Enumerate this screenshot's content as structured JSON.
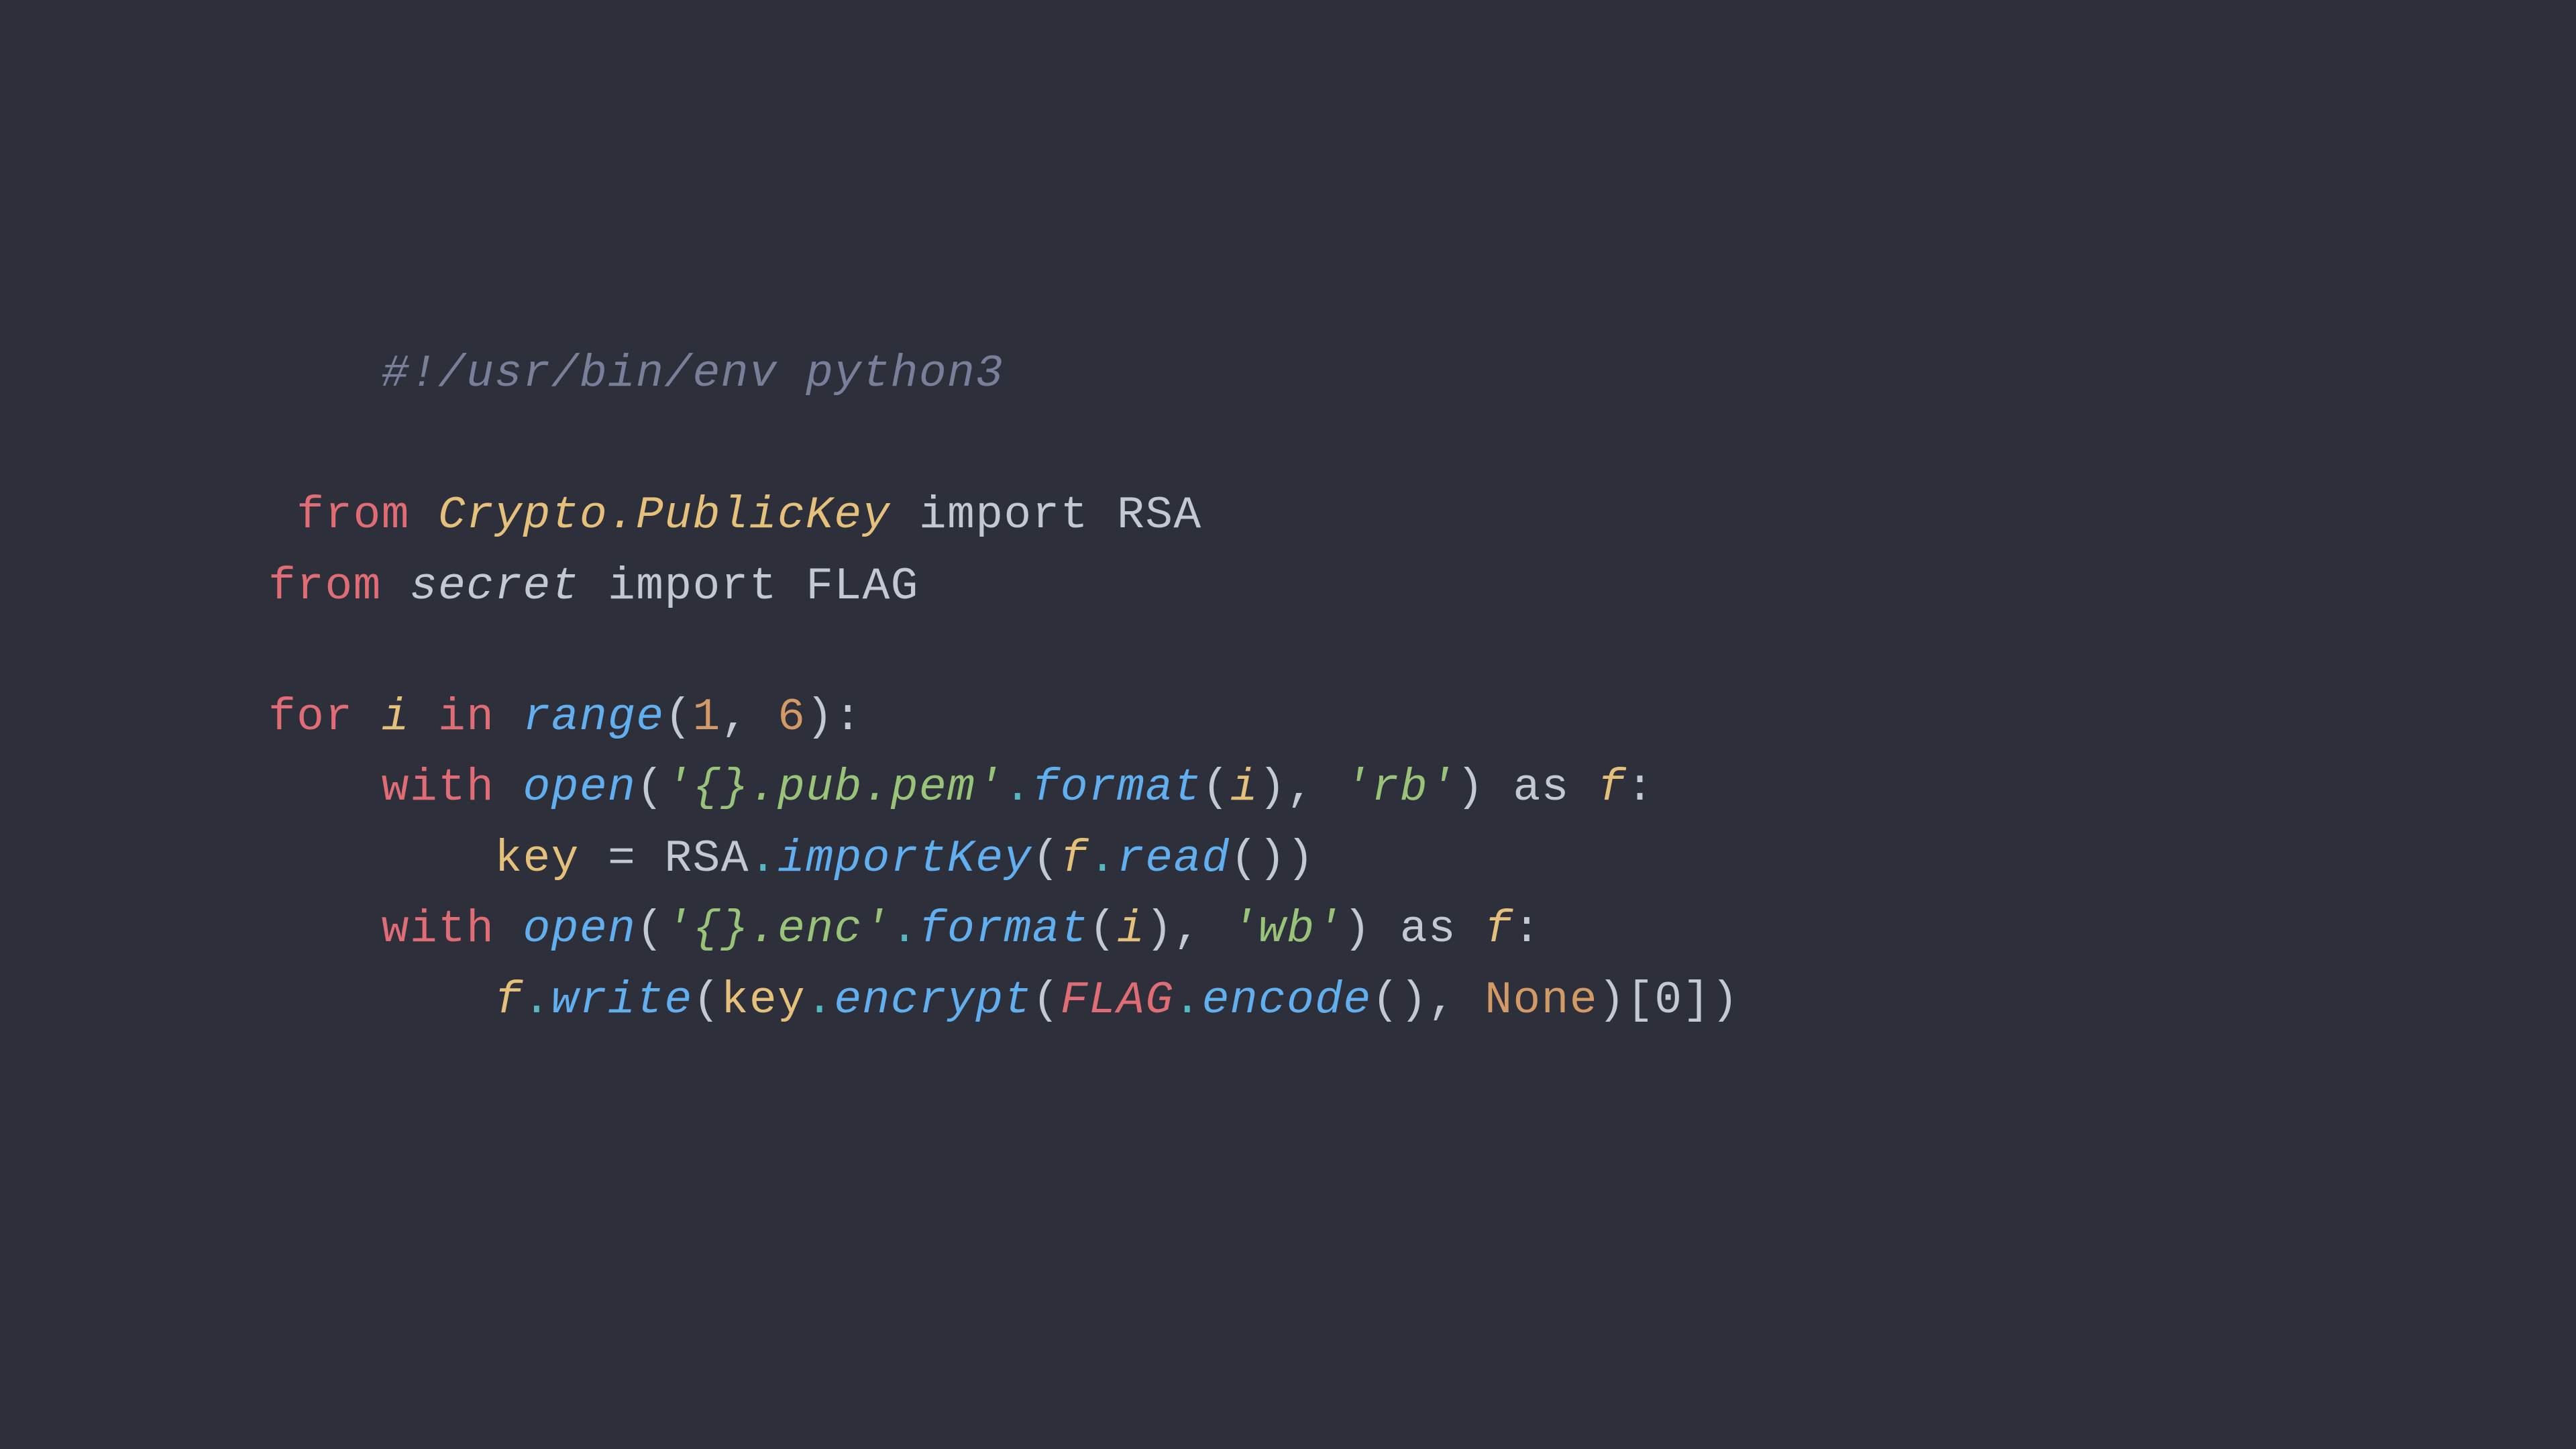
{
  "background": "#2d2f3a",
  "code": {
    "line1": "#!/usr/bin/env python3",
    "line2_from": "from",
    "line2_module": "Crypto.PublicKey",
    "line2_import": "import",
    "line2_name": "RSA",
    "line3_from": "from",
    "line3_module": "secret",
    "line3_import": "import",
    "line3_name": "FLAG",
    "line4_for": "for",
    "line4_i": "i",
    "line4_in": "in",
    "line4_range": "range",
    "line4_args": "(1, 6):",
    "line5_with": "with",
    "line5_open": "open",
    "line5_str1": "'{}.pub.pem'",
    "line5_dot": ".",
    "line5_format": "format",
    "line5_args1": "(i),",
    "line5_str2": "'rb'",
    "line5_as": "as",
    "line5_f": "f:",
    "line6_key": "key",
    "line6_eq": "=",
    "line6_rsa": "RSA",
    "line6_importkey": "importKey",
    "line6_f": "f",
    "line6_read": "read",
    "line7_with": "with",
    "line7_open": "open",
    "line7_str1": "'{}.enc'",
    "line7_dot": ".",
    "line7_format": "format",
    "line7_args1": "(i),",
    "line7_str2": "'wb'",
    "line7_as": "as",
    "line7_f": "f:",
    "line8_f": "f",
    "line8_write": "write",
    "line8_key": "key",
    "line8_encrypt": "encrypt",
    "line8_flag": "FLAG",
    "line8_dot": ".",
    "line8_encode": "encode",
    "line8_none": "None",
    "line8_end": "[0])"
  }
}
